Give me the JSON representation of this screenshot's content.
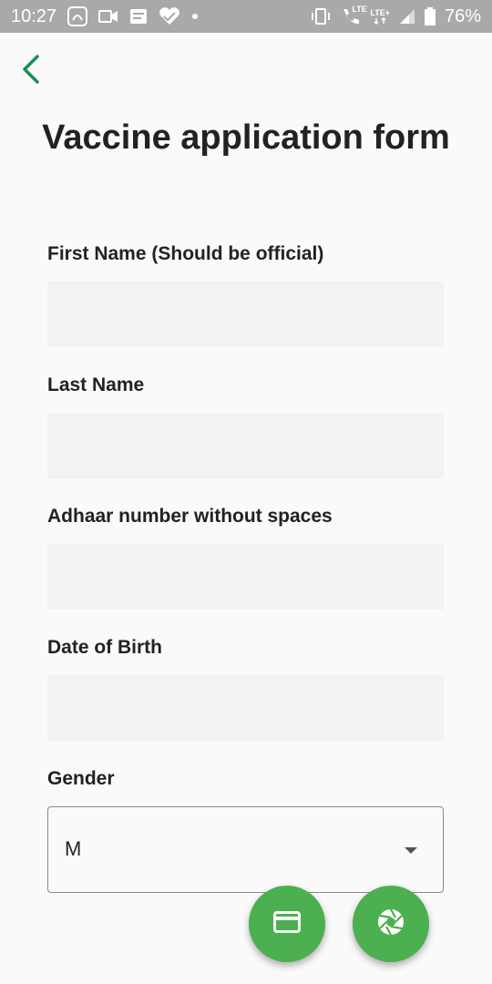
{
  "status_bar": {
    "time": "10:27",
    "lte1": "LTE",
    "lte2": "LTE+",
    "battery": "76%"
  },
  "page": {
    "title": "Vaccine application form"
  },
  "form": {
    "first_name_label": "First Name (Should be official)",
    "last_name_label": "Last Name",
    "adhaar_label": "Adhaar number without spaces",
    "dob_label": "Date of Birth",
    "gender_label": "Gender",
    "gender_value": "M"
  },
  "colors": {
    "accent": "#4caf50",
    "back_arrow": "#1e8c5a",
    "status_bar": "#a9a9a9"
  },
  "icons": {
    "back": "chevron-left-icon",
    "fab1": "credit-card-icon",
    "fab2": "camera-shutter-icon"
  }
}
